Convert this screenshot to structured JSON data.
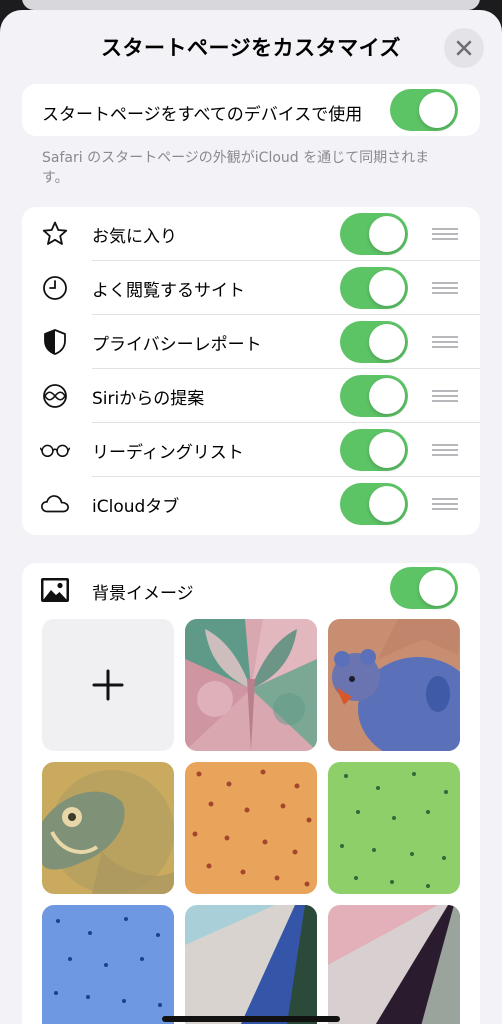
{
  "sheet": {
    "title": "スタートページをカスタマイズ",
    "close_icon": "xmark-icon"
  },
  "sync": {
    "label": "スタートページをすべてのデバイスで使用",
    "enabled": true,
    "footnote": "Safari のスタートページの外観がiCloud を通じて同期されます。"
  },
  "sections": [
    {
      "label": "お気に入り",
      "icon": "star-icon",
      "enabled": true
    },
    {
      "label": "よく閲覧するサイト",
      "icon": "clock-icon",
      "enabled": true
    },
    {
      "label": "プライバシーレポート",
      "icon": "shield-icon",
      "enabled": true
    },
    {
      "label": "Siriからの提案",
      "icon": "siri-icon",
      "enabled": true
    },
    {
      "label": "リーディングリスト",
      "icon": "glasses-icon",
      "enabled": true
    },
    {
      "label": "iCloudタブ",
      "icon": "cloud-icon",
      "enabled": true
    }
  ],
  "background": {
    "label": "背景イメージ",
    "icon": "photo-icon",
    "enabled": true,
    "add_icon": "plus-icon",
    "tiles": [
      {
        "name": "butterfly",
        "colors": [
          "#d59aa6",
          "#5c9c86"
        ]
      },
      {
        "name": "bear",
        "colors": [
          "#c68a6e",
          "#5b72ba"
        ]
      },
      {
        "name": "parrot",
        "colors": [
          "#c9aa5e",
          "#7f9277"
        ]
      },
      {
        "name": "orange-pattern",
        "colors": [
          "#e8a45a",
          "#a4462e"
        ]
      },
      {
        "name": "green-pattern",
        "colors": [
          "#8fcf6a",
          "#2f6a3a"
        ]
      },
      {
        "name": "blue-pattern",
        "colors": [
          "#6f98e2",
          "#1f3f8f"
        ]
      },
      {
        "name": "blue-geometric",
        "colors": [
          "#a9d0d9",
          "#3556a8"
        ]
      },
      {
        "name": "pink-geometric",
        "colors": [
          "#e3b0ba",
          "#2a1c2e"
        ]
      }
    ]
  }
}
